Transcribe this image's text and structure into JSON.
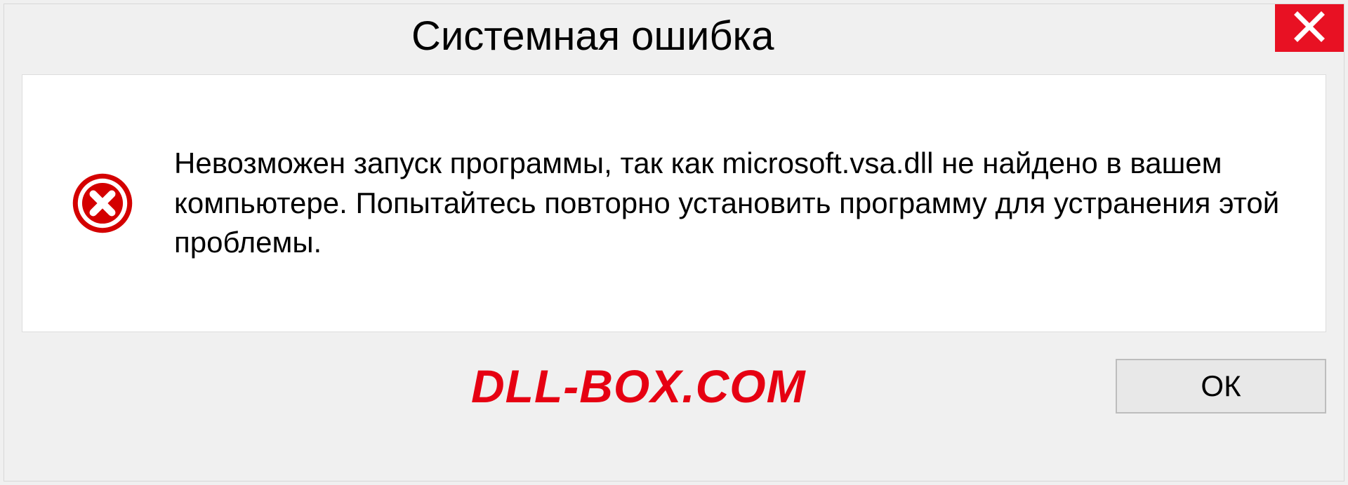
{
  "dialog": {
    "title": "Системная ошибка",
    "message": "Невозможен запуск программы, так как microsoft.vsa.dll  не найдено в вашем компьютере. Попытайтесь повторно установить программу для устранения этой проблемы.",
    "ok_label": "ОК"
  },
  "watermark": "DLL-BOX.COM",
  "colors": {
    "close_bg": "#e81123",
    "error_icon": "#d40000",
    "watermark": "#e60012"
  }
}
